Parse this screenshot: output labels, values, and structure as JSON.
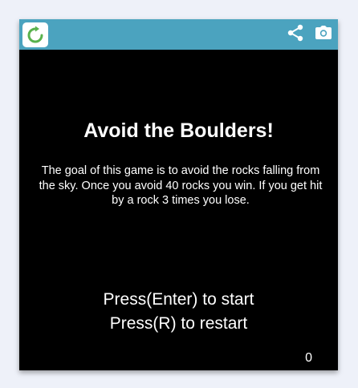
{
  "toolbar": {
    "reload_icon": "reload-icon",
    "share_icon": "share-icon",
    "camera_icon": "camera-icon",
    "bar_color": "#4ba3bf",
    "reload_icon_color": "#59b24d"
  },
  "game": {
    "title": "Avoid the Boulders!",
    "description": "The goal of this game is to avoid the rocks falling from the sky. Once you avoid 40 rocks you win. If you get hit by a rock 3 times you lose.",
    "start_prompt": "Press(Enter) to start",
    "restart_prompt": "Press(R) to restart",
    "score": "0",
    "background_color": "#000000",
    "text_color": "#ffffff"
  }
}
